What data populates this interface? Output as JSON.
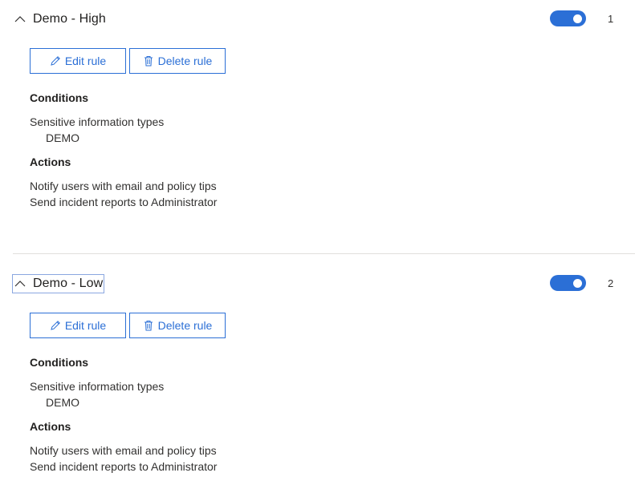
{
  "rules": [
    {
      "title": "Demo - High",
      "priority": "1",
      "enabled": true,
      "edit_label": "Edit rule",
      "delete_label": "Delete rule",
      "conditions_heading": "Conditions",
      "condition_type": "Sensitive information types",
      "condition_value": "DEMO",
      "actions_heading": "Actions",
      "actions": [
        "Notify users with email and policy tips",
        "Send incident reports to Administrator"
      ]
    },
    {
      "title": "Demo - Low",
      "priority": "2",
      "enabled": true,
      "edit_label": "Edit rule",
      "delete_label": "Delete rule",
      "conditions_heading": "Conditions",
      "condition_type": "Sensitive information types",
      "condition_value": "DEMO",
      "actions_heading": "Actions",
      "actions": [
        "Notify users with email and policy tips",
        "Send incident reports to Administrator"
      ]
    }
  ],
  "icons": {
    "collapse": "chevron-up-icon",
    "edit": "pencil-icon",
    "delete": "trash-icon"
  },
  "colors": {
    "accent": "#2b6fd6",
    "divider": "#e1dfdd",
    "text": "#323130"
  }
}
